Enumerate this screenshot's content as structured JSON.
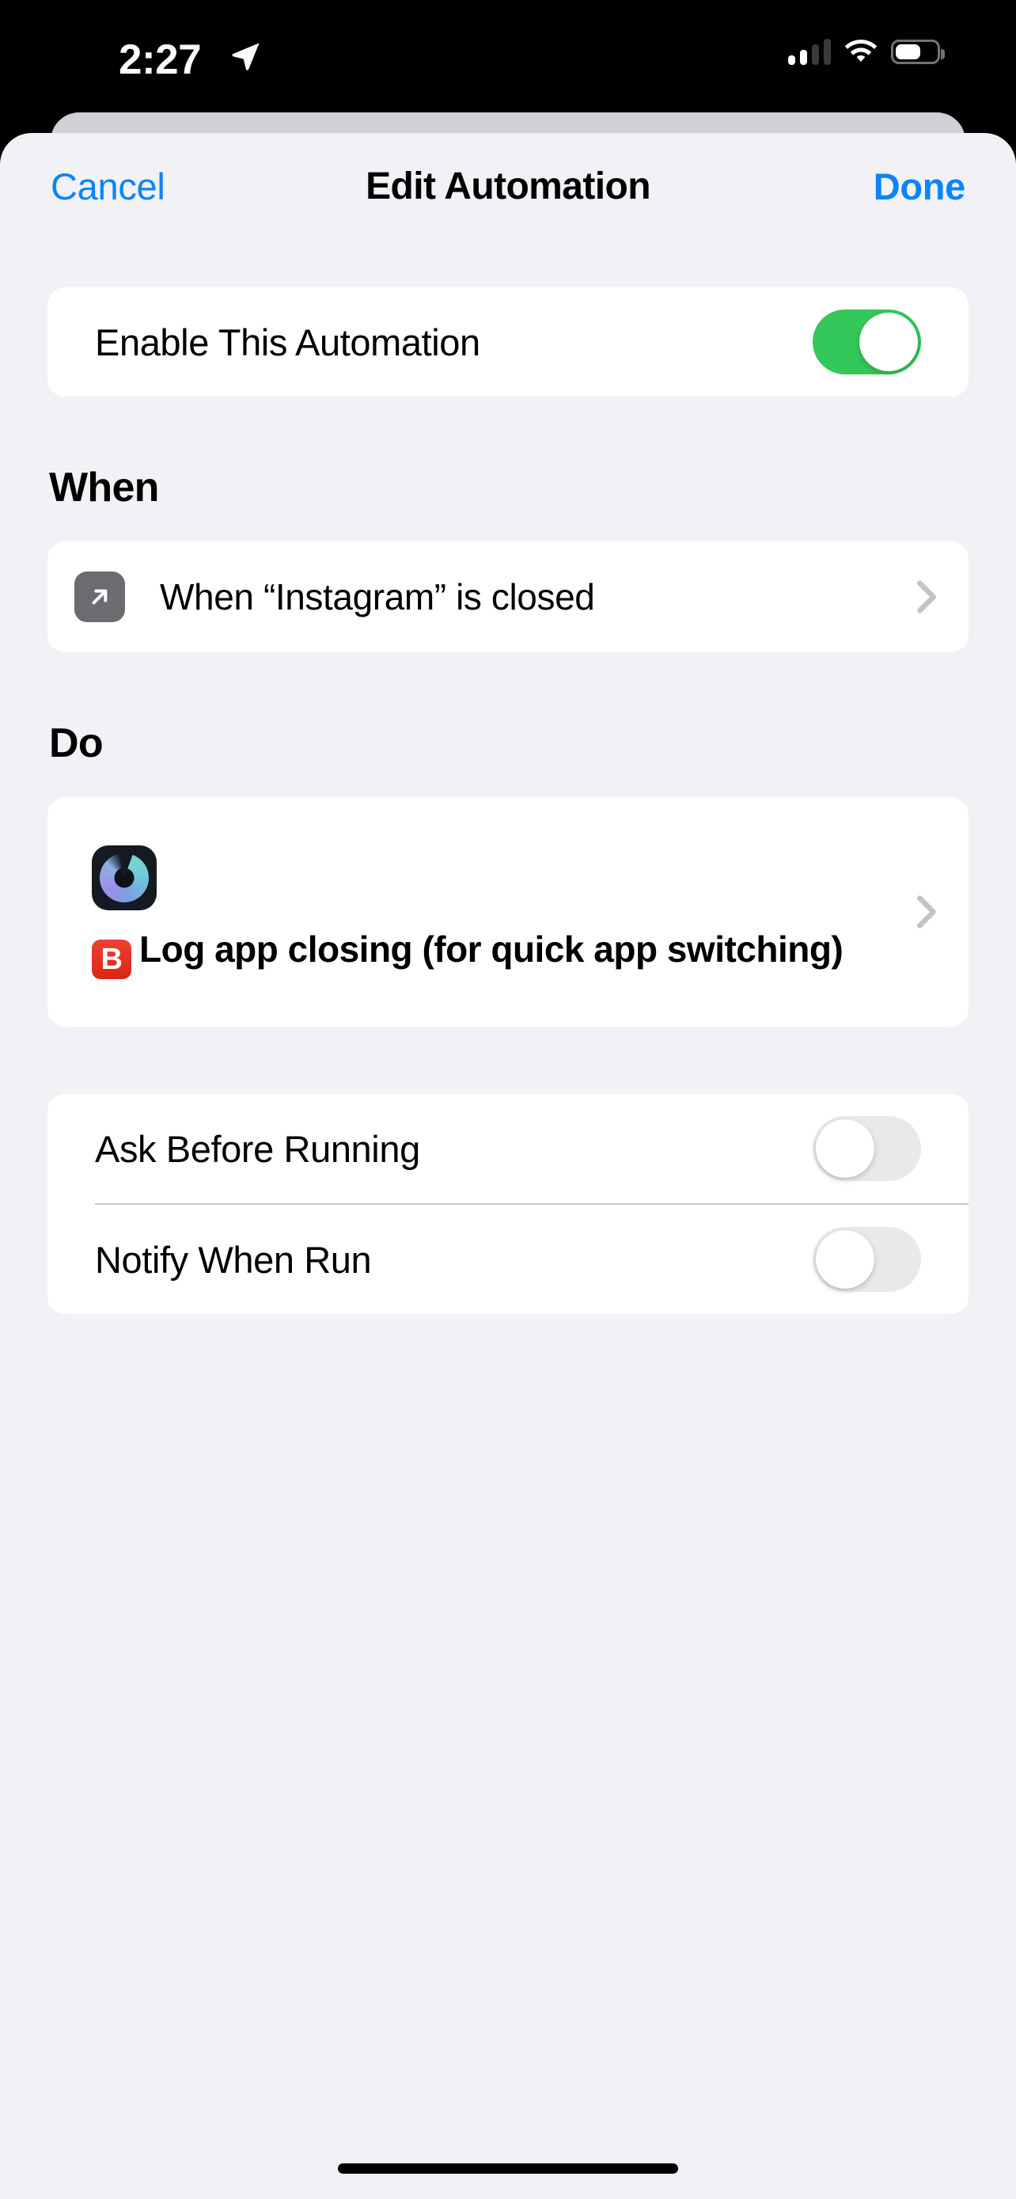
{
  "status_bar": {
    "time": "2:27",
    "location_icon": "location-arrow-icon",
    "signal_icon": "cellular-signal-icon",
    "signal_bars_filled": 2,
    "signal_bars_total": 4,
    "wifi_icon": "wifi-icon",
    "battery_icon": "battery-icon",
    "battery_percent": 55
  },
  "navbar": {
    "cancel_label": "Cancel",
    "title": "Edit Automation",
    "done_label": "Done",
    "tint_color": "#0a84ff"
  },
  "enable_row": {
    "label": "Enable This Automation",
    "toggle_state": "on",
    "toggle_on_color": "#34C759"
  },
  "when_section": {
    "heading": "When",
    "trigger": {
      "icon": "arrow-up-right-icon",
      "icon_background": "#6B6B70",
      "text": "When “Instagram” is closed",
      "chevron": "chevron-right-icon"
    }
  },
  "do_section": {
    "heading": "Do",
    "action": {
      "app_icon": "bear-app-icon",
      "badge_icon": "b-button-emoji",
      "badge_letter": "B",
      "text": "Log app closing (for quick app switching)",
      "chevron": "chevron-right-icon"
    }
  },
  "options": [
    {
      "label": "Ask Before Running",
      "toggle_state": "off"
    },
    {
      "label": "Notify When Run",
      "toggle_state": "off"
    }
  ],
  "home_indicator": "home-indicator"
}
